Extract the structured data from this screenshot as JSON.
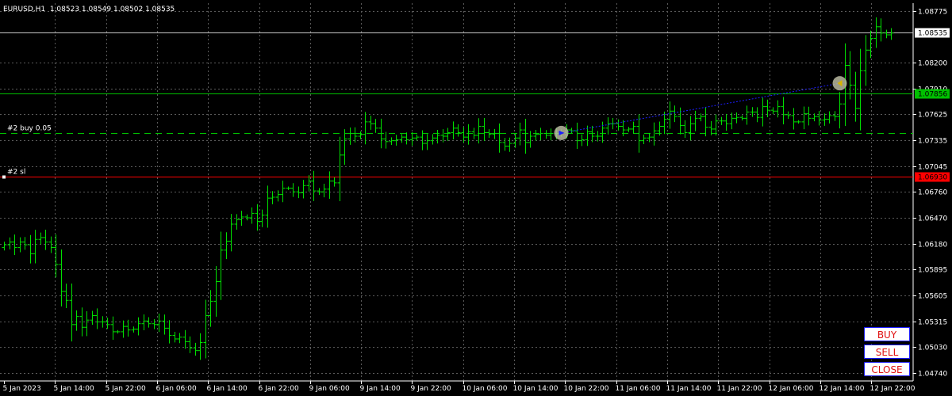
{
  "header": {
    "title": "EURUSD,H1  1.08523 1.08549 1.08502 1.08535"
  },
  "buttons": {
    "buy": "BUY",
    "sell": "SELL",
    "close": "CLOSE"
  },
  "lines": {
    "bid_price": "1.08535",
    "green_level": "1.07856",
    "red_level": "1.06930",
    "order_label": "#2 buy 0.05",
    "sl_label": "#2 sl"
  },
  "colors": {
    "background": "#000000",
    "grid": "#5a5a5a",
    "candles": "#00e000",
    "green_line": "#00c000",
    "red_line": "#ff0000",
    "trade_line": "#1c1cff",
    "button_border": "#1c1cff",
    "button_text": "#e01010"
  },
  "chart_data": {
    "type": "candlestick",
    "symbol": "EURUSD",
    "timeframe": "H1",
    "ylim": [
      1.0474,
      1.08775
    ],
    "yticks": [
      "1.08775",
      "1.08200",
      "1.07910",
      "1.07625",
      "1.07335",
      "1.07045",
      "1.06760",
      "1.06470",
      "1.06180",
      "1.05895",
      "1.05605",
      "1.05315",
      "1.05030",
      "1.04740"
    ],
    "xticks": [
      "5 Jan 2023",
      "5 Jan 14:00",
      "5 Jan 22:00",
      "6 Jan 06:00",
      "6 Jan 14:00",
      "6 Jan 22:00",
      "9 Jan 06:00",
      "9 Jan 14:00",
      "9 Jan 22:00",
      "10 Jan 06:00",
      "10 Jan 14:00",
      "10 Jan 22:00",
      "11 Jan 06:00",
      "11 Jan 14:00",
      "11 Jan 22:00",
      "12 Jan 06:00",
      "12 Jan 14:00",
      "12 Jan 22:00"
    ],
    "grid": true,
    "price_levels": {
      "bid": 1.08535,
      "green": 1.07856,
      "stop_loss": 1.0693,
      "order_open": 1.07416
    },
    "trade": {
      "entry": {
        "bar": 108,
        "price": 1.07416
      },
      "exit": {
        "bar": 162,
        "price": 1.0797
      }
    },
    "closes": [
      1.0617,
      1.062,
      1.0614,
      1.062,
      1.0617,
      1.0607,
      1.0623,
      1.0625,
      1.062,
      1.0614,
      1.0595,
      1.0565,
      1.0555,
      1.0528,
      1.0537,
      1.0525,
      1.0533,
      1.0538,
      1.0531,
      1.0531,
      1.0528,
      1.052,
      1.052,
      1.0526,
      1.0522,
      1.0523,
      1.0529,
      1.0532,
      1.0529,
      1.0528,
      1.0532,
      1.0524,
      1.0516,
      1.0512,
      1.0514,
      1.0509,
      1.0502,
      1.0499,
      1.0508,
      1.0538,
      1.0554,
      1.0576,
      1.0611,
      1.0621,
      1.064,
      1.0645,
      1.0648,
      1.0647,
      1.0652,
      1.0643,
      1.065,
      1.0669,
      1.067,
      1.0673,
      1.068,
      1.068,
      1.0676,
      1.0675,
      1.0683,
      1.0688,
      1.0677,
      1.0676,
      1.0679,
      1.0688,
      1.0686,
      1.0717,
      1.0735,
      1.0741,
      1.0738,
      1.074,
      1.0754,
      1.0752,
      1.0747,
      1.0735,
      1.0732,
      1.0733,
      1.0734,
      1.0737,
      1.0734,
      1.0736,
      1.0737,
      1.073,
      1.0733,
      1.0736,
      1.0739,
      1.0738,
      1.0742,
      1.0747,
      1.0742,
      1.0737,
      1.0743,
      1.0739,
      1.0749,
      1.0742,
      1.074,
      1.0741,
      1.0731,
      1.0727,
      1.073,
      1.0736,
      1.0745,
      1.0731,
      1.0738,
      1.074,
      1.0741,
      1.0739,
      1.0741,
      1.0741,
      1.0742,
      1.0745,
      1.0744,
      1.0733,
      1.0734,
      1.0743,
      1.0738,
      1.0738,
      1.0747,
      1.0752,
      1.0752,
      1.0749,
      1.0745,
      1.0746,
      1.0749,
      1.0733,
      1.0736,
      1.0737,
      1.0744,
      1.0749,
      1.0757,
      1.0766,
      1.076,
      1.075,
      1.0742,
      1.0752,
      1.0758,
      1.076,
      1.0748,
      1.0746,
      1.0755,
      1.0755,
      1.0752,
      1.0758,
      1.0759,
      1.0758,
      1.0765,
      1.0765,
      1.0759,
      1.0771,
      1.0767,
      1.0766,
      1.0771,
      1.0762,
      1.0761,
      1.0754,
      1.0754,
      1.0763,
      1.0758,
      1.076,
      1.0756,
      1.0757,
      1.0761,
      1.076,
      1.0774,
      1.0817,
      1.0795,
      1.0769,
      1.0811,
      1.0834,
      1.0847,
      1.086,
      1.0853,
      1.0851,
      1.0853
    ]
  }
}
